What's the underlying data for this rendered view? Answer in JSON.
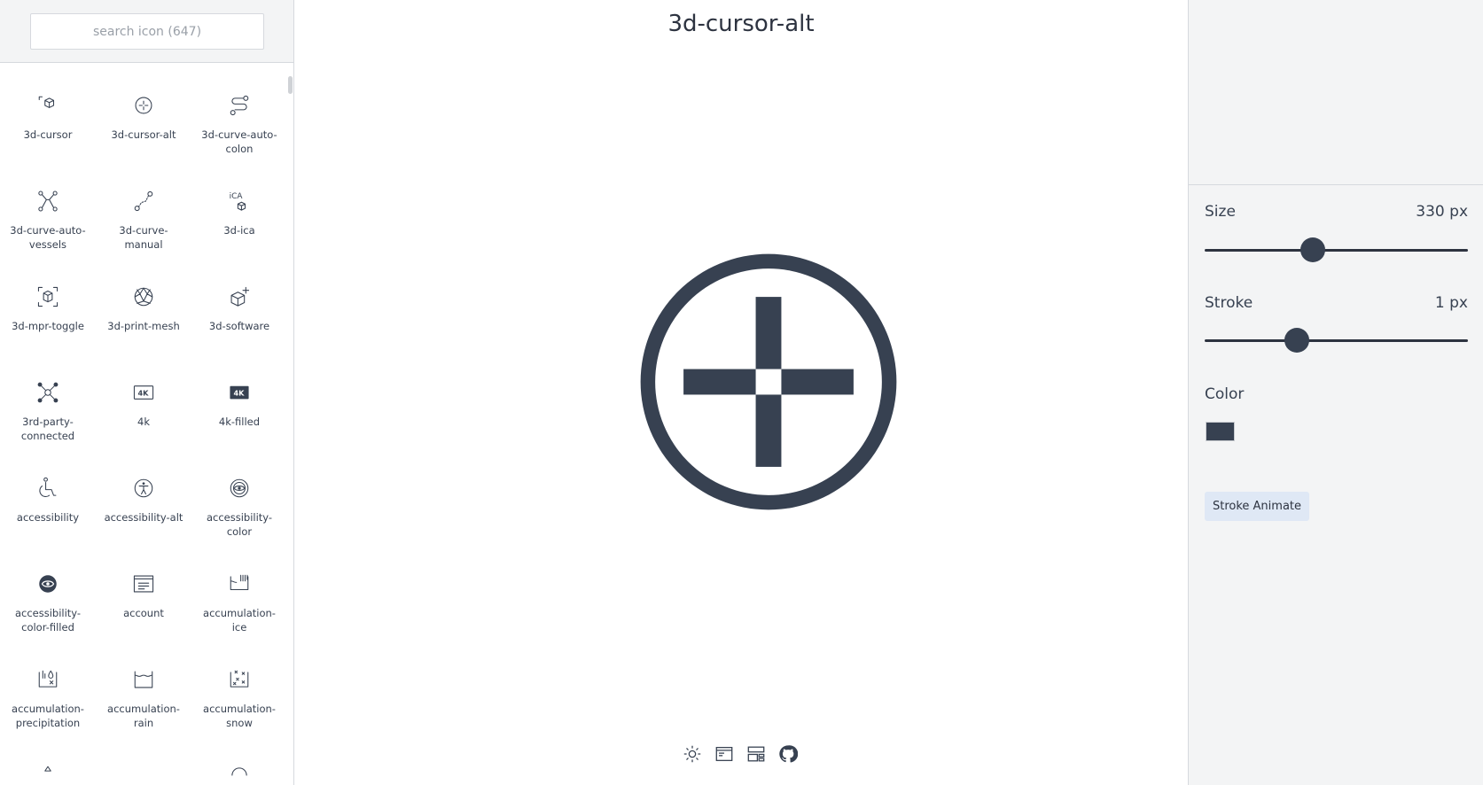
{
  "search": {
    "placeholder": "search icon (647)"
  },
  "icons": [
    {
      "label": "3d-cursor",
      "icon": "3d-cursor-icon"
    },
    {
      "label": "3d-cursor-alt",
      "icon": "3d-cursor-alt-icon"
    },
    {
      "label": "3d-curve-auto-colon",
      "icon": "3d-curve-auto-colon-icon"
    },
    {
      "label": "3d-curve-auto-vessels",
      "icon": "3d-curve-auto-vessels-icon"
    },
    {
      "label": "3d-curve-manual",
      "icon": "3d-curve-manual-icon"
    },
    {
      "label": "3d-ica",
      "icon": "3d-ica-icon"
    },
    {
      "label": "3d-mpr-toggle",
      "icon": "3d-mpr-toggle-icon"
    },
    {
      "label": "3d-print-mesh",
      "icon": "3d-print-mesh-icon"
    },
    {
      "label": "3d-software",
      "icon": "3d-software-icon"
    },
    {
      "label": "3rd-party-connected",
      "icon": "3rd-party-connected-icon"
    },
    {
      "label": "4k",
      "icon": "4k-icon"
    },
    {
      "label": "4k-filled",
      "icon": "4k-filled-icon"
    },
    {
      "label": "accessibility",
      "icon": "accessibility-icon"
    },
    {
      "label": "accessibility-alt",
      "icon": "accessibility-alt-icon"
    },
    {
      "label": "accessibility-color",
      "icon": "accessibility-color-icon"
    },
    {
      "label": "accessibility-color-filled",
      "icon": "accessibility-color-filled-icon"
    },
    {
      "label": "account",
      "icon": "account-icon"
    },
    {
      "label": "accumulation-ice",
      "icon": "accumulation-ice-icon"
    },
    {
      "label": "accumulation-precipitation",
      "icon": "accumulation-precipitation-icon"
    },
    {
      "label": "accumulation-rain",
      "icon": "accumulation-rain-icon"
    },
    {
      "label": "accumulation-snow",
      "icon": "accumulation-snow-icon"
    }
  ],
  "preview": {
    "title": "3d-cursor-alt",
    "icon": "3d-cursor-alt-icon"
  },
  "controls": {
    "size": {
      "label": "Size",
      "value": "330 px",
      "level": 0.41
    },
    "stroke": {
      "label": "Stroke",
      "value": "1 px",
      "level": 0.35
    },
    "color": {
      "label": "Color",
      "value": "#374151"
    },
    "animate_label": "Stroke Animate"
  },
  "footer": [
    "theme-toggle-icon",
    "layout-icon",
    "dashboard-icon",
    "github-icon"
  ],
  "colors": {
    "icon": "#374151",
    "panel_bg": "#f3f4f5",
    "button_bg": "#dfe8f5"
  }
}
